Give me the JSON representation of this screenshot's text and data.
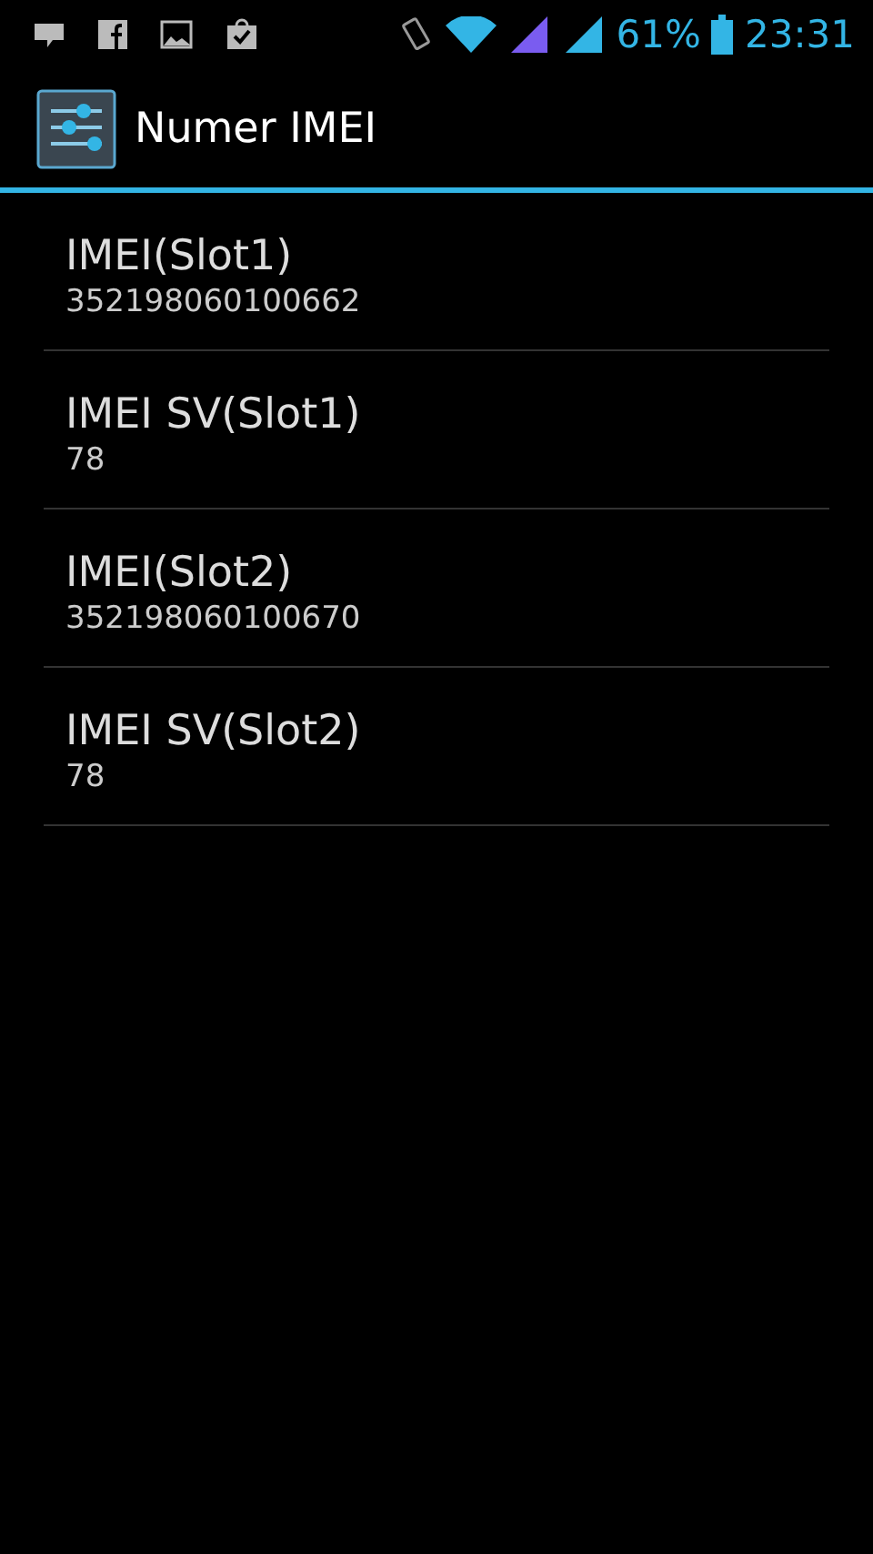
{
  "status_bar": {
    "battery": "61%",
    "time": "23:31"
  },
  "action_bar": {
    "title": "Numer IMEI"
  },
  "items": [
    {
      "title": "IMEI(Slot1)",
      "summary": "352198060100662"
    },
    {
      "title": "IMEI SV(Slot1)",
      "summary": "78"
    },
    {
      "title": "IMEI(Slot2)",
      "summary": "352198060100670"
    },
    {
      "title": "IMEI SV(Slot2)",
      "summary": "78"
    }
  ]
}
